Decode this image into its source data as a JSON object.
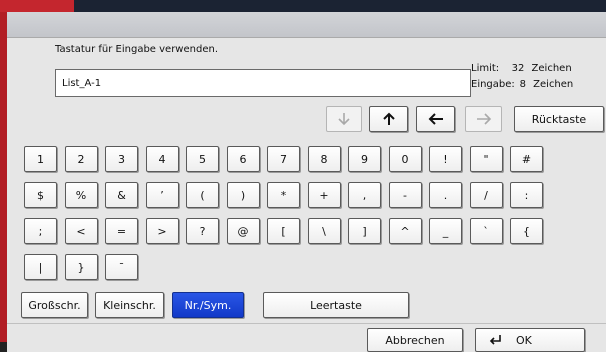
{
  "prompt": "Tastatur für Eingabe verwenden.",
  "input": {
    "value": "List_A-1"
  },
  "info": {
    "limit_label": "Limit:",
    "limit_value": "32",
    "limit_unit": "Zeichen",
    "entered_label": "Eingabe:",
    "entered_value": "8",
    "entered_unit": "Zeichen"
  },
  "nav": {
    "backspace_label": "Rücktaste"
  },
  "keys": {
    "row1": [
      "1",
      "2",
      "3",
      "4",
      "5",
      "6",
      "7",
      "8",
      "9",
      "0",
      "!",
      "\"",
      "#"
    ],
    "row2": [
      "$",
      "%",
      "&",
      "’",
      "(",
      ")",
      "*",
      "+",
      ",",
      "-",
      ".",
      "/",
      ":"
    ],
    "row3": [
      ";",
      "<",
      "=",
      ">",
      "?",
      "@",
      "[",
      "\\",
      "]",
      "^",
      "_",
      "`",
      "{"
    ],
    "row4": [
      "|",
      "}",
      "¯"
    ]
  },
  "modes": {
    "uppercase": "Großschr.",
    "lowercase": "Kleinschr.",
    "numsym": "Nr./Sym.",
    "space": "Leertaste"
  },
  "footer": {
    "cancel": "Abbrechen",
    "ok": "OK"
  },
  "colors": {
    "active_key": "#1e48d8",
    "accent_red": "#c4262e",
    "topbar": "#1b2333"
  }
}
